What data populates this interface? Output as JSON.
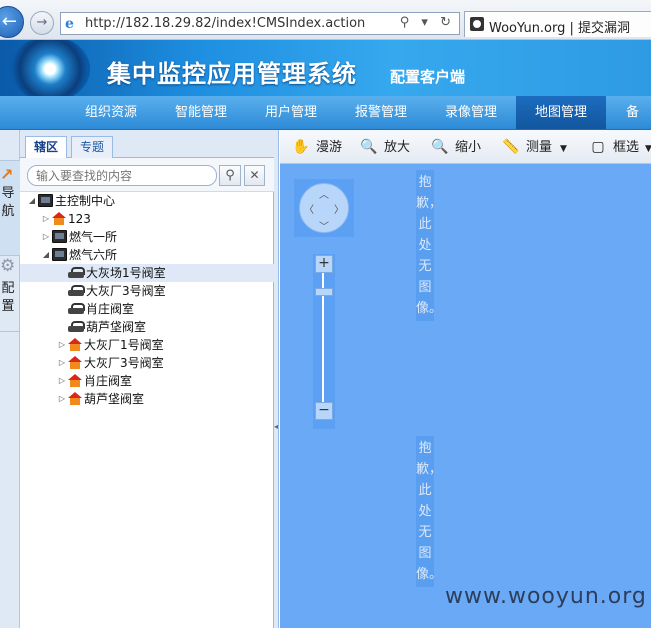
{
  "browser": {
    "url": "http://182.18.29.82/index!CMSIndex.action",
    "tab_title": "WooYun.org | 提交漏洞",
    "address_tools": "⚲ ▾ ↻"
  },
  "header": {
    "title": "集中监控应用管理系统",
    "subtitle": "配置客户端"
  },
  "menu": {
    "items": [
      {
        "label": "组织资源"
      },
      {
        "label": "智能管理"
      },
      {
        "label": "用户管理"
      },
      {
        "label": "报警管理"
      },
      {
        "label": "录像管理"
      },
      {
        "label": "地图管理",
        "active": true
      },
      {
        "label": "备份"
      }
    ]
  },
  "strip": {
    "nav_label": "导航",
    "config_label": "配置"
  },
  "panel": {
    "tabs": [
      "辖区",
      "专题"
    ],
    "search_placeholder": "输入要查找的内容"
  },
  "tree": [
    {
      "label": "主控制中心",
      "icon": "monitor-icon",
      "level": 0,
      "expanded": true
    },
    {
      "label": "123",
      "icon": "house-icon",
      "level": 1,
      "expanded": false
    },
    {
      "label": "燃气一所",
      "icon": "monitor-icon",
      "level": 1,
      "expanded": false
    },
    {
      "label": "燃气六所",
      "icon": "monitor-icon",
      "level": 1,
      "expanded": true
    },
    {
      "label": "大灰场1号阀室",
      "icon": "car-icon",
      "level": 2,
      "selected": true
    },
    {
      "label": "大灰厂3号阀室",
      "icon": "car-icon",
      "level": 2
    },
    {
      "label": "肖庄阀室",
      "icon": "car-icon",
      "level": 2
    },
    {
      "label": "葫芦垡阀室",
      "icon": "car-icon",
      "level": 2
    },
    {
      "label": "大灰厂1号阀室",
      "icon": "house-icon",
      "level": 2,
      "expanded": false
    },
    {
      "label": "大灰厂3号阀室",
      "icon": "house-icon",
      "level": 2,
      "expanded": false
    },
    {
      "label": "肖庄阀室",
      "icon": "house-icon",
      "level": 2,
      "expanded": false
    },
    {
      "label": "葫芦垡阀室",
      "icon": "house-icon",
      "level": 2,
      "expanded": false
    }
  ],
  "map_toolbar": {
    "tools": [
      {
        "label": "漫游",
        "icon": "hand-icon"
      },
      {
        "label": "放大",
        "icon": "zoom-in-icon"
      },
      {
        "label": "缩小",
        "icon": "zoom-out-icon"
      },
      {
        "label": "测量",
        "icon": "ruler-icon"
      },
      {
        "label": "框选",
        "icon": "box-select-icon"
      }
    ]
  },
  "map": {
    "tile_message": "抱歉，此处无图像。",
    "watermark": "www.wooyun.org",
    "background_color": "#6aa9f5"
  }
}
